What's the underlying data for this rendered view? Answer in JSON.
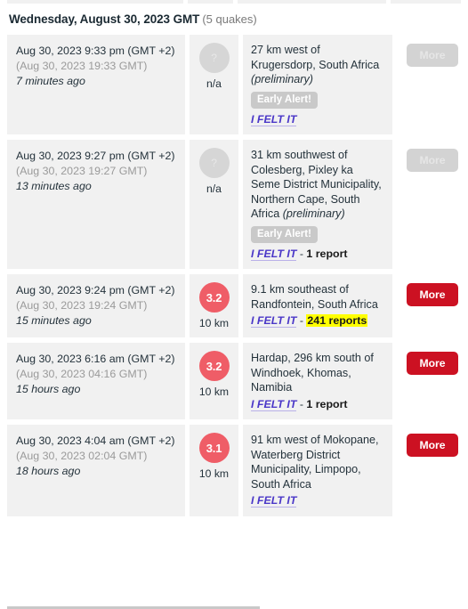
{
  "header": {
    "day_title": "Wednesday, August 30, 2023 GMT",
    "quake_count": "(5 quakes)"
  },
  "labels": {
    "more": "More",
    "early_alert": "Early Alert!",
    "felt_it": "I FELT IT",
    "unknown_magnitude_glyph": "?",
    "unknown_depth": "n/a",
    "separator": " - "
  },
  "colors": {
    "felt_magnitude_circle": "#ef5d67",
    "unknown_magnitude_circle": "#d6d6d6",
    "more_button_primary": "#cc1122",
    "more_button_muted": "#d3d3d3",
    "felt_link": "#4b38c8",
    "highlight": "#ffff00",
    "cell_background": "#f1f1f1"
  },
  "quakes": [
    {
      "time_local": "Aug 30, 2023 9:33 pm (GMT +2)",
      "time_gmt": "(Aug 30, 2023 19:33 GMT)",
      "time_ago": "7 minutes ago",
      "magnitude": "?",
      "magnitude_state": "unknown",
      "depth": "n/a",
      "place": "27 km west of Krugersdorp, South Africa",
      "preliminary": "(preliminary)",
      "early_alert": "Early Alert!",
      "felt_it": "I FELT IT",
      "reports": "",
      "reports_highlighted": false,
      "more_label": "More",
      "more_style": "muted"
    },
    {
      "time_local": "Aug 30, 2023 9:27 pm (GMT +2)",
      "time_gmt": "(Aug 30, 2023 19:27 GMT)",
      "time_ago": "13 minutes ago",
      "magnitude": "?",
      "magnitude_state": "unknown",
      "depth": "n/a",
      "place": "31 km southwest of Colesberg, Pixley ka Seme District Municipality, Northern Cape, South Africa",
      "preliminary": "(preliminary)",
      "early_alert": "Early Alert!",
      "felt_it": "I FELT IT",
      "reports": "1 report",
      "reports_highlighted": false,
      "more_label": "More",
      "more_style": "muted"
    },
    {
      "time_local": "Aug 30, 2023 9:24 pm (GMT +2)",
      "time_gmt": "(Aug 30, 2023 19:24 GMT)",
      "time_ago": "15 minutes ago",
      "magnitude": "3.2",
      "magnitude_state": "felt",
      "depth": "10 km",
      "place": "9.1 km southeast of Randfontein, South Africa",
      "preliminary": "",
      "early_alert": "",
      "felt_it": "I FELT IT",
      "reports": "241 reports",
      "reports_highlighted": true,
      "more_label": "More",
      "more_style": "primary"
    },
    {
      "time_local": "Aug 30, 2023 6:16 am (GMT +2)",
      "time_gmt": "(Aug 30, 2023 04:16 GMT)",
      "time_ago": "15 hours ago",
      "magnitude": "3.2",
      "magnitude_state": "felt",
      "depth": "10 km",
      "place": "Hardap, 296 km south of Windhoek, Khomas, Namibia",
      "preliminary": "",
      "early_alert": "",
      "felt_it": "I FELT IT",
      "reports": "1 report",
      "reports_highlighted": false,
      "more_label": "More",
      "more_style": "primary"
    },
    {
      "time_local": "Aug 30, 2023 4:04 am (GMT +2)",
      "time_gmt": "(Aug 30, 2023 02:04 GMT)",
      "time_ago": "18 hours ago",
      "magnitude": "3.1",
      "magnitude_state": "felt",
      "depth": "10 km",
      "place": "91 km west of Mokopane, Waterberg District Municipality, Limpopo, South Africa",
      "preliminary": "",
      "early_alert": "",
      "felt_it": "I FELT IT",
      "reports": "",
      "reports_highlighted": false,
      "more_label": "More",
      "more_style": "primary"
    }
  ]
}
